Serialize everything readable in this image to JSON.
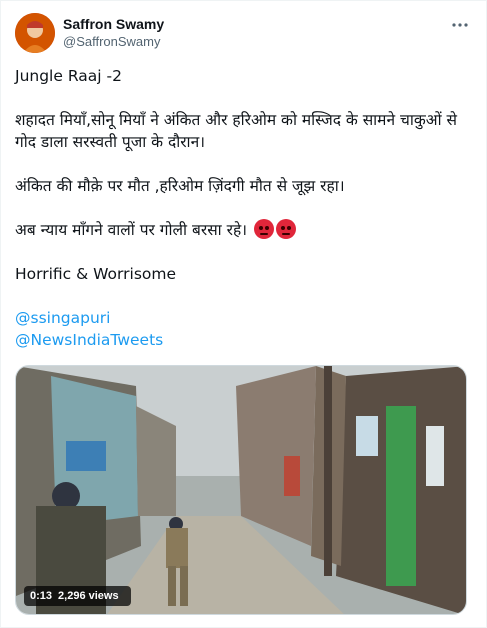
{
  "author": {
    "display_name": "Saffron Swamy",
    "handle": "@SaffronSwamy"
  },
  "tweet": {
    "line1": "Jungle Raaj -2",
    "line2": "शहादत मियाँ,सोनू मियाँ ने अंकित और हरिओम को मस्जिद के सामने चाकुओं से गोद डाला सरस्वती पूजा के दौरान।",
    "line3": "अंकित की मौक़े पर मौत ,हरिओम ज़िंदगी मौत से जूझ रहा।",
    "line4": "अब न्याय माँगने वालों पर गोली बरसा रहे।",
    "line5": "Horrific & Worrisome",
    "mention1": "@ssingapuri",
    "mention2": "@NewsIndiaTweets",
    "emoji_names": [
      "angry-face-icon",
      "angry-face-icon"
    ]
  },
  "video": {
    "duration": "0:13",
    "views": "2,296 views"
  },
  "colors": {
    "link": "#1d9bf0",
    "text": "#0f1419",
    "secondary": "#536471"
  }
}
